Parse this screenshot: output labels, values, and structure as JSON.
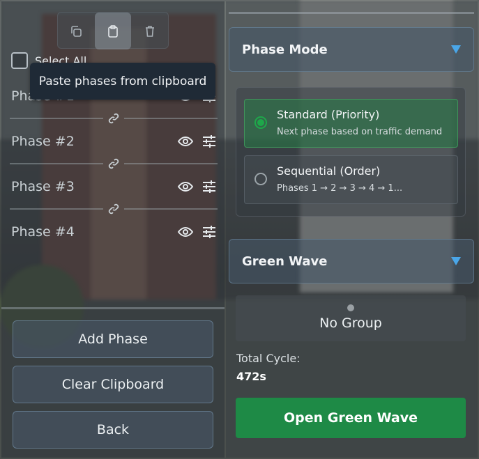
{
  "toolbar": {
    "copy_icon": "copy-icon",
    "paste_icon": "clipboard-icon",
    "delete_icon": "trash-icon"
  },
  "select_all": {
    "label": "Select All",
    "checked": false
  },
  "tooltip": {
    "text": "Paste phases from clipboard"
  },
  "phases": [
    {
      "label": "Phase #1"
    },
    {
      "label": "Phase #2"
    },
    {
      "label": "Phase #3"
    },
    {
      "label": "Phase #4"
    }
  ],
  "left_buttons": {
    "add": "Add Phase",
    "clear": "Clear Clipboard",
    "back": "Back"
  },
  "phase_mode": {
    "title": "Phase Mode",
    "options": [
      {
        "title": "Standard (Priority)",
        "subtitle": "Next phase based on traffic demand",
        "selected": true
      },
      {
        "title": "Sequential (Order)",
        "subtitle": "Phases 1 → 2 → 3 → 4 → 1...",
        "selected": false
      }
    ]
  },
  "green_wave": {
    "title": "Green Wave",
    "group": "No Group",
    "total_cycle_label": "Total Cycle:",
    "total_cycle_value": "472s",
    "open_button": "Open Green Wave"
  },
  "colors": {
    "accent_blue": "#4aa6e8",
    "green": "#1e8a46",
    "tooltip_bg": "#1f2a36"
  }
}
